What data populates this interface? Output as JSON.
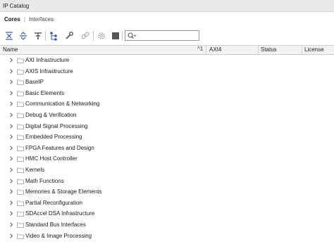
{
  "window": {
    "title": "IP Catalog"
  },
  "tabs": [
    {
      "label": "Cores"
    },
    {
      "label": "Interfaces"
    }
  ],
  "tab_separator": "|",
  "toolbar": {
    "buttons": [
      {
        "icon": "collapse-all-icon"
      },
      {
        "icon": "expand-all-icon"
      },
      {
        "icon": "filter-icon"
      },
      {
        "icon": "hierarchy-icon"
      },
      {
        "icon": "wrench-icon"
      },
      {
        "icon": "link-icon"
      },
      {
        "icon": "gear-icon"
      },
      {
        "icon": "stop-icon"
      }
    ],
    "search": {
      "value": "",
      "placeholder": ""
    }
  },
  "table": {
    "columns": [
      {
        "label": "Name"
      },
      {
        "label": "AXI4"
      },
      {
        "label": "Status"
      },
      {
        "label": "License"
      }
    ],
    "sort_indicator": "^1",
    "rows": [
      {
        "label": "AXI Infrastructure"
      },
      {
        "label": "AXIS Infrastructure"
      },
      {
        "label": "BaseIP"
      },
      {
        "label": "Basic Elements"
      },
      {
        "label": "Communication & Networking"
      },
      {
        "label": "Debug & Verification"
      },
      {
        "label": "Digital Signal Processing"
      },
      {
        "label": "Embedded Processing"
      },
      {
        "label": "FPGA Features and Design"
      },
      {
        "label": "HMC Host Controller"
      },
      {
        "label": "Kernels"
      },
      {
        "label": "Math Functions"
      },
      {
        "label": "Memories & Storage Elements"
      },
      {
        "label": "Partial Reconfiguration"
      },
      {
        "label": "SDAccel DSA Infrastructure"
      },
      {
        "label": "Standard Bus Interfaces"
      },
      {
        "label": "Video & Image Processing"
      }
    ]
  }
}
